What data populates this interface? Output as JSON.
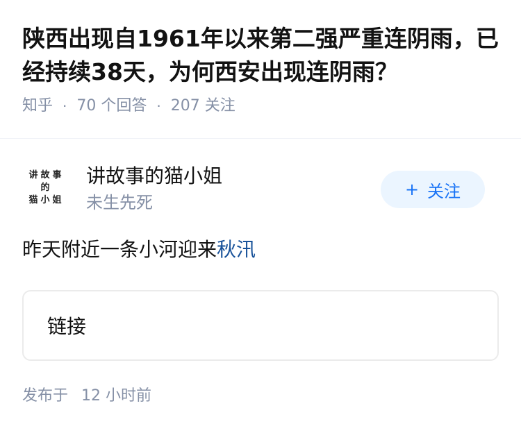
{
  "question": {
    "title": "陕西出现自1961年以来第二强严重连阴雨，已经持续38天，为何西安出现连阴雨？",
    "source": "知乎",
    "separator": "·",
    "answers": "70 个回答",
    "followers": "207 关注"
  },
  "author": {
    "avatar_lines": [
      "讲故事",
      "的",
      "猫小姐"
    ],
    "name": "讲故事的猫小姐",
    "bio": "未生先死",
    "follow_plus": "+",
    "follow_label": "关注"
  },
  "answer": {
    "text": "昨天附近一条小河迎来",
    "link_text": "秋汛",
    "card_label": "链接",
    "published_label": "发布于",
    "published_time": "12 小时前"
  },
  "colors": {
    "accent": "#1772f6",
    "link": "#175199",
    "meta": "#8590a6",
    "follow_bg": "#ebf5ff"
  }
}
